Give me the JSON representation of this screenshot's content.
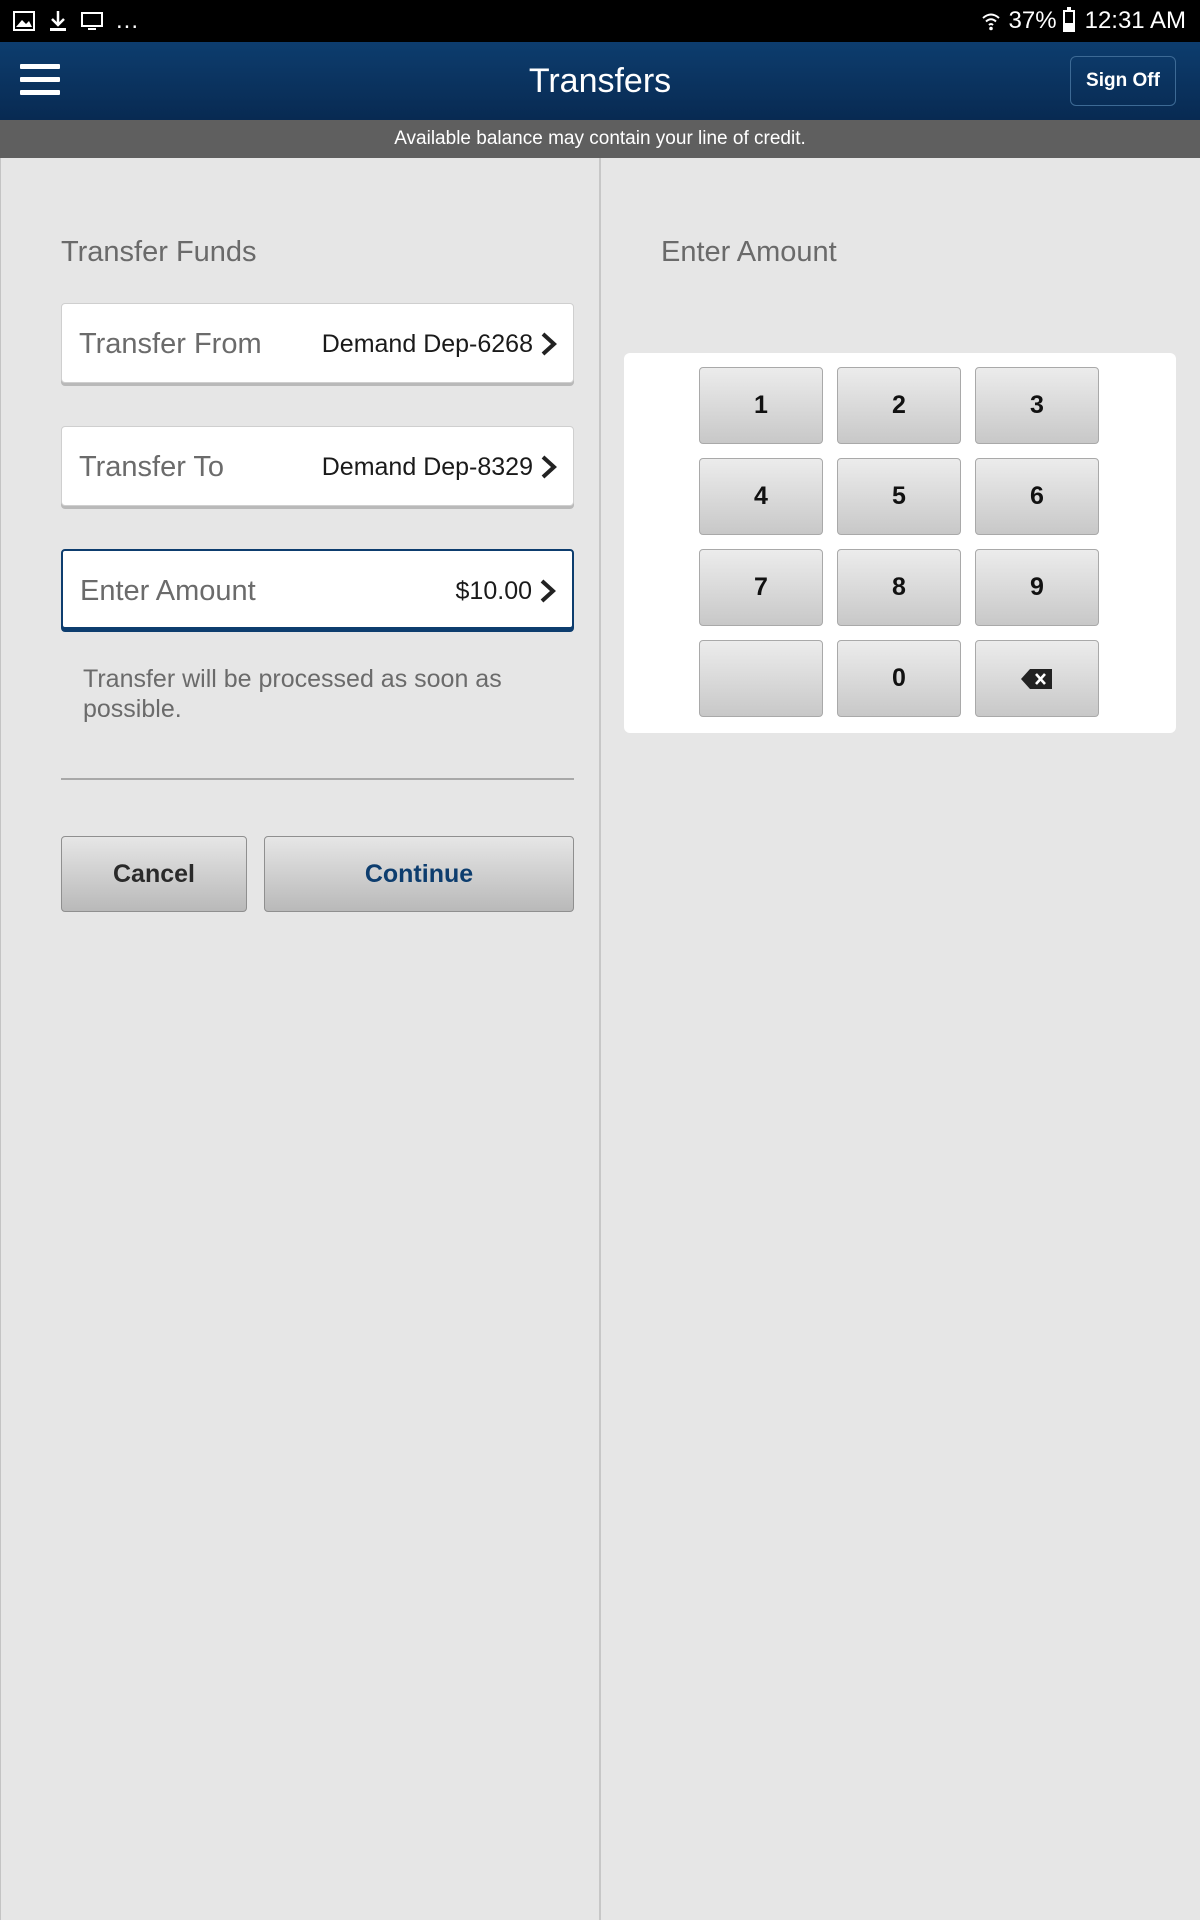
{
  "status_bar": {
    "left_icons": [
      "image-icon",
      "download-icon",
      "screen-cast-icon"
    ],
    "more": "...",
    "battery": "37%",
    "time": "12:31 AM"
  },
  "header": {
    "title": "Transfers",
    "sign_off_label": "Sign Off"
  },
  "banner": {
    "text": "Available balance may contain your line of credit."
  },
  "left_pane": {
    "title": "Transfer Funds",
    "fields": [
      {
        "label": "Transfer From",
        "value": "Demand Dep-6268"
      },
      {
        "label": "Transfer To",
        "value": "Demand Dep-8329"
      },
      {
        "label": "Enter Amount",
        "value": "$10.00"
      }
    ],
    "note": "Transfer will be processed as soon as possible.",
    "cancel_label": "Cancel",
    "continue_label": "Continue"
  },
  "right_pane": {
    "title": "Enter Amount",
    "keys": [
      "1",
      "2",
      "3",
      "4",
      "5",
      "6",
      "7",
      "8",
      "9",
      "",
      "0"
    ],
    "backspace_icon": "backspace-icon"
  },
  "colors": {
    "header": "#0d3d6e",
    "banner": "#5f5f5f",
    "background": "#e6e6e6",
    "continue_text": "#0d3d6e"
  }
}
